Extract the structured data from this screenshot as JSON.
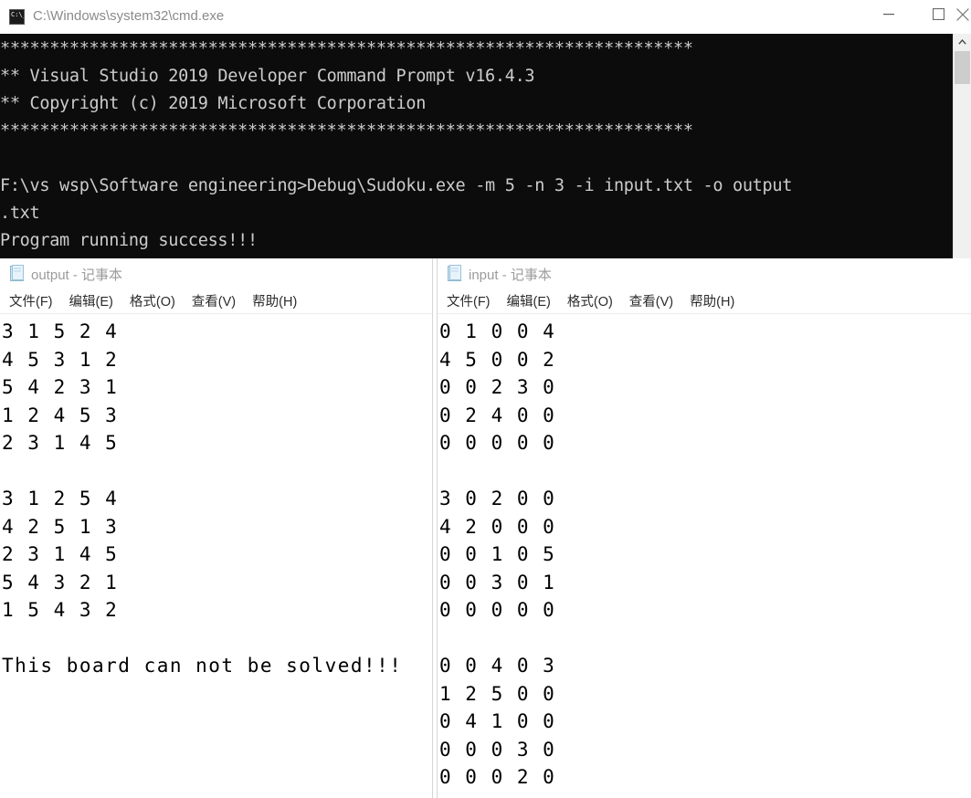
{
  "console": {
    "title": "C:\\Windows\\system32\\cmd.exe",
    "icon": "cmd-icon",
    "icon_glyph": "C:\\_",
    "controls": {
      "minimize_label": "minimize",
      "maximize_label": "maximize",
      "close_label": "close"
    },
    "lines": [
      "**********************************************************************",
      "** Visual Studio 2019 Developer Command Prompt v16.4.3",
      "** Copyright (c) 2019 Microsoft Corporation",
      "**********************************************************************",
      "",
      "F:\\vs wsp\\Software engineering>Debug\\Sudoku.exe -m 5 -n 3 -i input.txt -o output",
      ".txt",
      "Program running success!!!"
    ],
    "background": "#0c0c0c",
    "foreground": "#cccccc",
    "scrollbar": {
      "up_arrow": "chevron-up-icon",
      "thumb_position_pct": 8
    }
  },
  "notepad_output": {
    "title": "output - 记事本",
    "icon": "notepad-icon",
    "menu": [
      "文件(F)",
      "编辑(E)",
      "格式(O)",
      "查看(V)",
      "帮助(H)"
    ],
    "content_lines": [
      "3 1 5 2 4",
      "4 5 3 1 2",
      "5 4 2 3 1",
      "1 2 4 5 3",
      "2 3 1 4 5",
      "",
      "3 1 2 5 4",
      "4 2 5 1 3",
      "2 3 1 4 5",
      "5 4 3 2 1",
      "1 5 4 3 2",
      "",
      "This board can not be solved!!!"
    ]
  },
  "notepad_input": {
    "title": "input - 记事本",
    "icon": "notepad-icon",
    "menu": [
      "文件(F)",
      "编辑(E)",
      "格式(O)",
      "查看(V)",
      "帮助(H)"
    ],
    "content_lines": [
      "0 1 0 0 4",
      "4 5 0 0 2",
      "0 0 2 3 0",
      "0 2 4 0 0",
      "0 0 0 0 0",
      "",
      "3 0 2 0 0",
      "4 2 0 0 0",
      "0 0 1 0 5",
      "0 0 3 0 1",
      "0 0 0 0 0",
      "",
      "0 0 4 0 3",
      "1 2 5 0 0",
      "0 4 1 0 0",
      "0 0 0 3 0",
      "0 0 0 2 0"
    ]
  }
}
